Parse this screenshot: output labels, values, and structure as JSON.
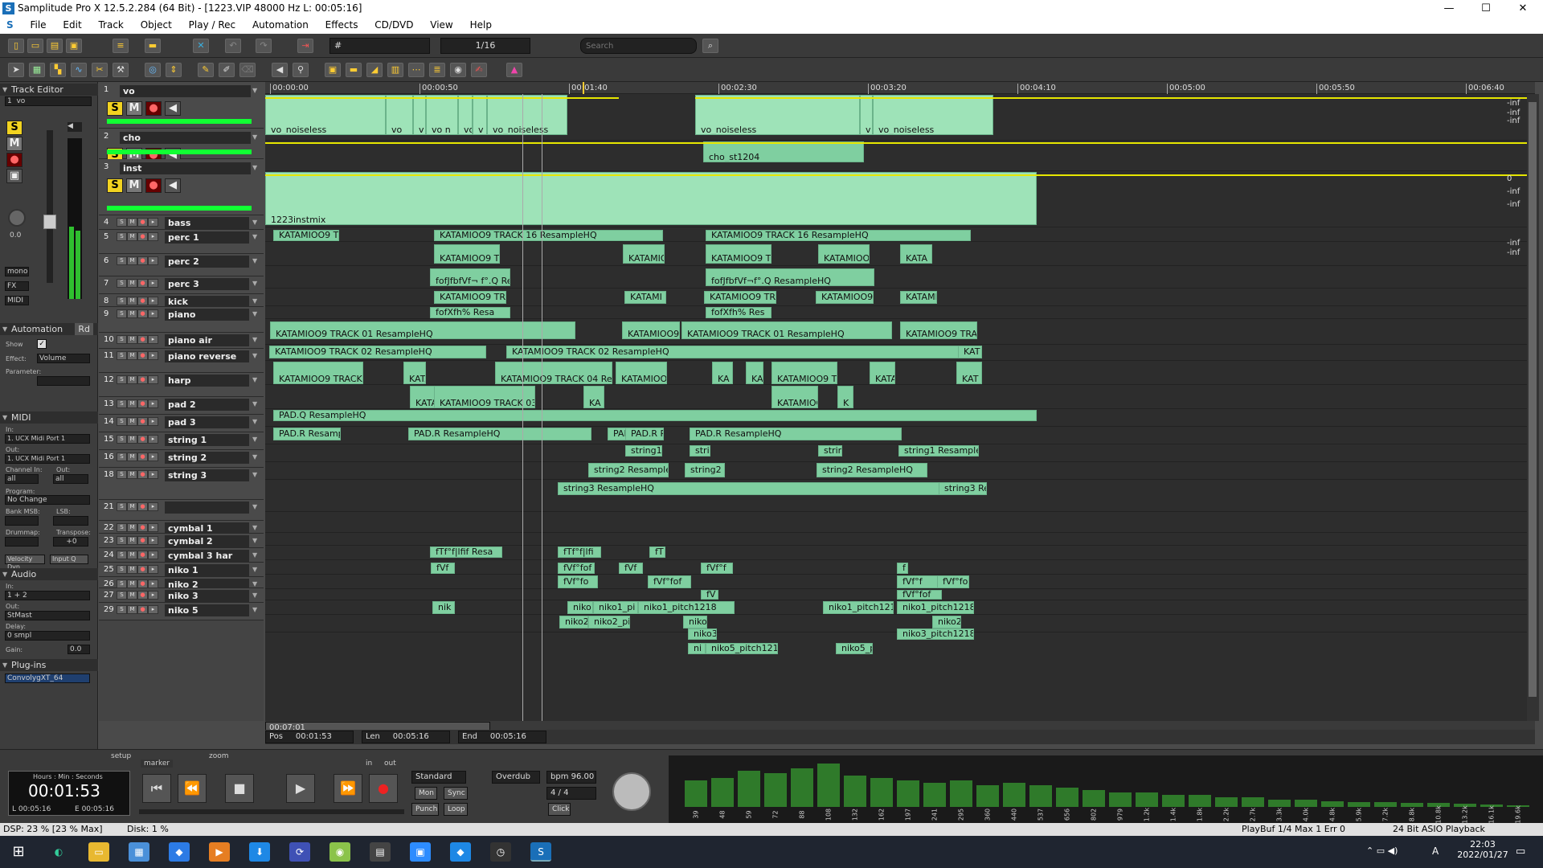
{
  "window": {
    "title": "Samplitude Pro X 12.5.2.284 (64 Bit) - [1223.VIP   48000 Hz L: 00:05:16]",
    "minimize": "—",
    "maximize": "☐",
    "close": "✕"
  },
  "menu": [
    "File",
    "Edit",
    "Track",
    "Object",
    "Play / Rec",
    "Automation",
    "Effects",
    "CD/DVD",
    "View",
    "Help"
  ],
  "toolbar": {
    "grid_value": "#",
    "quantize": "1/16",
    "search_placeholder": "Search"
  },
  "left": {
    "track_editor": "Track Editor",
    "track_selected": "1",
    "track_name": "vo",
    "db": "0.0",
    "mono": "mono",
    "fx": "FX",
    "midi": "MIDI",
    "automation": "Automation",
    "rd": "Rd",
    "show": "Show",
    "effect_label": "Effect:",
    "effect": "Volume",
    "parameter": "Parameter:",
    "midi_section": "MIDI",
    "in": "In:",
    "in_port": "1. UCX Midi Port 1",
    "out": "Out:",
    "out_port": "1. UCX Midi Port 1",
    "channel_in": "Channel In:",
    "channel_out": "Out:",
    "all": "all",
    "program": "Program:",
    "no_change": "No Change",
    "bank": "Bank MSB:",
    "lsb": "LSB:",
    "drummap": "Drummap:",
    "transpose": "Transpose:",
    "transpose_val": "+0",
    "velocity": "Velocity Dyn",
    "input_q": "Input Q",
    "audio": "Audio",
    "audio_in": "In:",
    "audio_in_val": "1 + 2",
    "audio_out": "Out:",
    "audio_out_val": "StMast",
    "delay": "Delay:",
    "delay_val": "0 smpl",
    "gain": "Gain:",
    "gain_val": "0.0",
    "plugins": "Plug-ins",
    "plugin": "ConvolygXT_64"
  },
  "tracks": [
    {
      "n": "1",
      "name": "vo"
    },
    {
      "n": "2",
      "name": "cho"
    },
    {
      "n": "3",
      "name": "inst"
    },
    {
      "n": "4",
      "name": "bass"
    },
    {
      "n": "5",
      "name": "perc 1"
    },
    {
      "n": "6",
      "name": "perc 2"
    },
    {
      "n": "7",
      "name": "perc 3"
    },
    {
      "n": "8",
      "name": "kick"
    },
    {
      "n": "9",
      "name": "piano"
    },
    {
      "n": "10",
      "name": "piano air"
    },
    {
      "n": "11",
      "name": "piano reverse"
    },
    {
      "n": "12",
      "name": "harp"
    },
    {
      "n": "13",
      "name": "pad 2"
    },
    {
      "n": "14",
      "name": "pad 3"
    },
    {
      "n": "15",
      "name": "string 1"
    },
    {
      "n": "16",
      "name": "string 2"
    },
    {
      "n": "18",
      "name": "string 3"
    },
    {
      "n": "21",
      "name": ""
    },
    {
      "n": "22",
      "name": "cymbal 1"
    },
    {
      "n": "23",
      "name": "cymbal 2"
    },
    {
      "n": "24",
      "name": "cymbal 3 har"
    },
    {
      "n": "25",
      "name": "niko 1"
    },
    {
      "n": "26",
      "name": "niko 2"
    },
    {
      "n": "27",
      "name": "niko 3"
    },
    {
      "n": "29",
      "name": "niko 5"
    }
  ],
  "ruler": [
    "00:00:00",
    "00:00:50",
    "00:01:40",
    "00:02:30",
    "00:03:20",
    "00:04:10",
    "00:05:00",
    "00:05:50",
    "00:06:40"
  ],
  "objects": {
    "vo1": "vo_noiseless",
    "vo2": "vo",
    "vo3": "v",
    "vo4": "vo n",
    "vo5": "vo",
    "vo6": "v",
    "vo7": "vo_noiseless",
    "vo8": "vo_noiseless",
    "vo9": "v",
    "vo10": "vo_noiseless",
    "cho1": "cho_st1204",
    "inst1": "1223instmix",
    "b1": "KATAMIOO9 TRA",
    "b2": "KATAMIOO9 TRACK 16  ResampleHQ",
    "b3": "KATAMIOO9 TRACK 16  ResampleHQ",
    "p1a": "KATAMIOO9 TR",
    "p1b": "KATAMIO",
    "p1c": "KATAMIOO9 TRA",
    "p1d": "KATAMIOO9",
    "p1e": "KATA",
    "p2a": "fofJfbfVf¬ f°.Q  Re",
    "p2b": "fofJfbfVf¬f°.Q  ResampleHQ",
    "p3a": "KATAMIOO9 TRAC",
    "p3b": "KATAMI",
    "p3c": "KATAMIOO9 TRACK",
    "p3d": "KATAMIOO9 T",
    "p3e": "KATAMI",
    "k1": "fofXfh%  Resa",
    "k2": "fofXfh%  Res",
    "pi1": "KATAMIOO9 TRACK 01  ResampleHQ",
    "pi2": "KATAMIOO9 T",
    "pi3": "KATAMIOO9 TRACK 01  ResampleHQ",
    "pi4": "KATAMIOO9 TRACK",
    "pa1": "KATAMIOO9 TRACK 02  ResampleHQ",
    "pa2": "KATAMIOO9 TRACK 02  ResampleHQ",
    "pa3": "KAT",
    "pr1": "KATAMIOO9 TRACK 04",
    "pr2": "KATA",
    "pr3": "KATAMIOO9 TRACK 04  Resam",
    "pr4": "KATAMIOO9",
    "pr5": "KA",
    "pr6": "KA",
    "pr7": "KATAMIOO9 TRA",
    "pr8": "KATA",
    "pr9": "KAT",
    "h1": "KATAM",
    "h2": "KATAMIOO9 TRACK 03  Res",
    "h3": "KA",
    "h4": "KATAMIOO",
    "h5": "K",
    "pd2": "PAD.Q  ResampleHQ",
    "pd3a": "PAD.R  Resample",
    "pd3b": "PAD.R  ResampleHQ",
    "pd3c": "PAD.R  R",
    "pd3d": "PAD.R  R",
    "pd3e": "PAD.R  ResampleHQ",
    "s1a": "string1",
    "s1b": "stri",
    "s1c": "strin",
    "s1d": "string1  ResampleHQ",
    "s2a": "string2  Resample",
    "s2b": "string2",
    "s2c": "string2  ResampleHQ",
    "s3a": "string3  ResampleHQ",
    "s3b": "string3  Re",
    "c1a": "fTf°f|lfif  Resa",
    "c1b": "fTf°f|lfi",
    "c1c": "fT",
    "c2a": "fVf",
    "c2b": "fVf°fof",
    "c2c": "fVf",
    "c2d": "fVf°f",
    "c2e": "f",
    "c3a": "fVf°fo",
    "c3b": "fVf°fof",
    "c3c": "fVf°f",
    "c3d": "fVf°fo",
    "c3e": "fV",
    "c3f": "fVf°fof",
    "n1a": "nik",
    "n1b": "niko1",
    "n1c": "niko1_pi",
    "n1d": "niko1_pitch1218",
    "n1e": "niko1_pitch1218",
    "n1f": "niko1_pitch1218",
    "n2a": "niko2",
    "n2b": "niko2_pi",
    "n2c": "niko",
    "n2d": "niko2",
    "n3a": "niko3",
    "n3b": "niko3_pitch1218",
    "n5a": "ni",
    "n5b": "niko5_pitch1218",
    "n5c": "niko5_p"
  },
  "meterscale": [
    "-inf",
    "-inf",
    "-inf",
    "0",
    "-inf",
    "-inf",
    "-inf",
    "-inf"
  ],
  "status": {
    "pos_label": "Pos",
    "pos": "00:01:53",
    "len_label": "Len",
    "len": "00:05:16",
    "end_label": "End",
    "end": "00:05:16",
    "scroll_time": "00:07:01"
  },
  "transport": {
    "clock_label": "Hours : Min : Seconds",
    "clock": "00:01:53",
    "l": "00:05:16",
    "e": "00:05:16",
    "mode": "Standard",
    "mon": "Mon",
    "sync": "Sync",
    "punch": "Punch",
    "loop": "Loop",
    "overdub": "Overdub",
    "bpm": "bpm 96.00",
    "sig": "4 / 4",
    "click": "Click",
    "marker": "marker",
    "in": "in",
    "out": "out",
    "setup": "setup",
    "zoom": "zoom"
  },
  "meters": [
    {
      "lab": "39",
      "v": 0.55
    },
    {
      "lab": "48",
      "v": 0.6
    },
    {
      "lab": "59",
      "v": 0.75
    },
    {
      "lab": "72",
      "v": 0.7
    },
    {
      "lab": "88",
      "v": 0.8
    },
    {
      "lab": "108",
      "v": 0.9
    },
    {
      "lab": "132",
      "v": 0.65
    },
    {
      "lab": "162",
      "v": 0.6
    },
    {
      "lab": "197",
      "v": 0.55
    },
    {
      "lab": "241",
      "v": 0.5
    },
    {
      "lab": "295",
      "v": 0.55
    },
    {
      "lab": "360",
      "v": 0.45
    },
    {
      "lab": "440",
      "v": 0.5
    },
    {
      "lab": "537",
      "v": 0.45
    },
    {
      "lab": "656",
      "v": 0.4
    },
    {
      "lab": "802",
      "v": 0.35
    },
    {
      "lab": "979",
      "v": 0.3
    },
    {
      "lab": "1.2k",
      "v": 0.3
    },
    {
      "lab": "1.4k",
      "v": 0.25
    },
    {
      "lab": "1.8k",
      "v": 0.25
    },
    {
      "lab": "2.2k",
      "v": 0.2
    },
    {
      "lab": "2.7k",
      "v": 0.2
    },
    {
      "lab": "3.3k",
      "v": 0.15
    },
    {
      "lab": "4.0k",
      "v": 0.15
    },
    {
      "lab": "4.8k",
      "v": 0.12
    },
    {
      "lab": "5.9k",
      "v": 0.1
    },
    {
      "lab": "7.2k",
      "v": 0.1
    },
    {
      "lab": "8.8k",
      "v": 0.08
    },
    {
      "lab": "10.8k",
      "v": 0.08
    },
    {
      "lab": "13.2k",
      "v": 0.06
    },
    {
      "lab": "16.1k",
      "v": 0.05
    },
    {
      "lab": "19.6k",
      "v": 0.04
    }
  ],
  "dsp": "DSP: 23 %  [23 % Max]",
  "disk": "Disk:   1 %",
  "playbuf": "PlayBuf 1/4  Max 1  Err 0",
  "asio": "24 Bit ASIO Playback",
  "clock": {
    "time": "22:03",
    "date": "2022/01/27"
  },
  "taskbar_lang": "A"
}
